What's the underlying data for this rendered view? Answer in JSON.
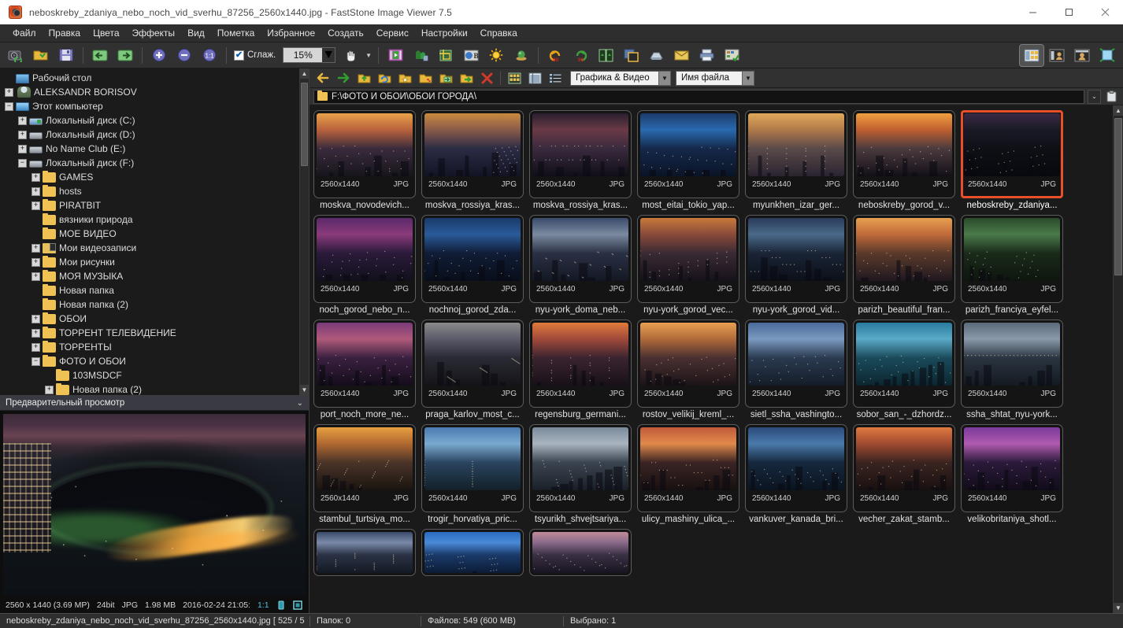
{
  "window": {
    "title": "neboskreby_zdaniya_nebo_noch_vid_sverhu_87256_2560x1440.jpg  -  FastStone Image Viewer 7.5",
    "app_icon": "faststone-icon",
    "minimize": "–",
    "maximize": "□",
    "close": "✕"
  },
  "menubar": {
    "items": [
      {
        "label": "Файл",
        "name": "menu-file"
      },
      {
        "label": "Правка",
        "name": "menu-edit"
      },
      {
        "label": "Цвета",
        "name": "menu-colors"
      },
      {
        "label": "Эффекты",
        "name": "menu-effects"
      },
      {
        "label": "Вид",
        "name": "menu-view"
      },
      {
        "label": "Пометка",
        "name": "menu-tag"
      },
      {
        "label": "Избранное",
        "name": "menu-favorites"
      },
      {
        "label": "Создать",
        "name": "menu-create"
      },
      {
        "label": "Сервис",
        "name": "menu-tools"
      },
      {
        "label": "Настройки",
        "name": "menu-settings"
      },
      {
        "label": "Справка",
        "name": "menu-help"
      }
    ]
  },
  "toolbar": {
    "smooth_label": "Сглаж.",
    "smooth_checked": "✔",
    "zoom_value": "15%",
    "dropdown_arrow": "▼",
    "buttons": [
      "camera-refresh-icon",
      "open-folder-icon",
      "save-icon",
      "previous-arrow-icon",
      "next-arrow-icon",
      "zoom-in-icon",
      "zoom-out-icon",
      "actual-size-icon"
    ],
    "buttons2": [
      "hand-pan-icon",
      "slideshow-icon",
      "resize-icon",
      "crop-icon",
      "color-adjust-icon",
      "brightness-icon",
      "red-eye-icon",
      "rotate-left-icon",
      "rotate-right-icon",
      "compare-icon",
      "drop-shadow-icon",
      "scan-icon",
      "email-icon",
      "print-icon",
      "contact-sheet-icon"
    ],
    "right_buttons": [
      "browser-view-icon",
      "preview-view-icon",
      "fullscreen-view-icon",
      "exit-icon"
    ]
  },
  "navbar": {
    "buttons": [
      "back-arrow-icon",
      "forward-arrow-icon",
      "up-folder-icon",
      "refresh-folder-icon",
      "favorites-folder-icon",
      "new-folder-icon",
      "copy-to-icon",
      "move-to-icon",
      "delete-icon",
      "thumbnail-view-icon",
      "list-view-icon",
      "detail-view-icon"
    ],
    "filter_select": "Графика & Видео",
    "sort_select": "Имя файла",
    "dropdown_arrow": "▼"
  },
  "pathbar": {
    "path": "F:\\ФОТО И ОБОИ\\ОБОИ ГОРОДА\\",
    "folder_icon": "folder-icon",
    "caret": "⌄",
    "copy_icon": "clipboard-icon"
  },
  "tree": {
    "scroll_up": "▲",
    "scroll_down": "▼",
    "items": [
      {
        "label": "Рабочий стол",
        "indent": 0,
        "expander": "",
        "icon": "desktop"
      },
      {
        "label": "ALEKSANDR BORISOV",
        "indent": 0,
        "expander": "+",
        "icon": "user"
      },
      {
        "label": "Этот компьютер",
        "indent": 0,
        "expander": "−",
        "icon": "pc"
      },
      {
        "label": "Локальный диск (C:)",
        "indent": 1,
        "expander": "+",
        "icon": "drive-sys"
      },
      {
        "label": "Локальный диск (D:)",
        "indent": 1,
        "expander": "+",
        "icon": "drive"
      },
      {
        "label": "No Name Club (E:)",
        "indent": 1,
        "expander": "+",
        "icon": "drive"
      },
      {
        "label": "Локальный диск (F:)",
        "indent": 1,
        "expander": "−",
        "icon": "drive"
      },
      {
        "label": "GAMES",
        "indent": 2,
        "expander": "+",
        "icon": "folder"
      },
      {
        "label": "hosts",
        "indent": 2,
        "expander": "+",
        "icon": "folder"
      },
      {
        "label": "PIRATBIT",
        "indent": 2,
        "expander": "+",
        "icon": "folder"
      },
      {
        "label": "вязники природа",
        "indent": 2,
        "expander": "",
        "icon": "folder"
      },
      {
        "label": "МОЕ ВИДЕО",
        "indent": 2,
        "expander": "",
        "icon": "folder"
      },
      {
        "label": "Мои видеозаписи",
        "indent": 2,
        "expander": "+",
        "icon": "vid"
      },
      {
        "label": "Мои рисунки",
        "indent": 2,
        "expander": "+",
        "icon": "folder"
      },
      {
        "label": "МОЯ МУЗЫКА",
        "indent": 2,
        "expander": "+",
        "icon": "folder"
      },
      {
        "label": "Новая папка",
        "indent": 2,
        "expander": "",
        "icon": "folder"
      },
      {
        "label": "Новая папка (2)",
        "indent": 2,
        "expander": "",
        "icon": "folder"
      },
      {
        "label": "ОБОИ",
        "indent": 2,
        "expander": "+",
        "icon": "folder"
      },
      {
        "label": "ТОРРЕНТ ТЕЛЕВИДЕНИЕ",
        "indent": 2,
        "expander": "+",
        "icon": "folder"
      },
      {
        "label": "ТОРРЕНТЫ",
        "indent": 2,
        "expander": "+",
        "icon": "folder"
      },
      {
        "label": "ФОТО И ОБОИ",
        "indent": 2,
        "expander": "−",
        "icon": "folder"
      },
      {
        "label": "103MSDCF",
        "indent": 3,
        "expander": "",
        "icon": "folder"
      },
      {
        "label": "Новая папка (2)",
        "indent": 3,
        "expander": "+",
        "icon": "folder"
      }
    ]
  },
  "preview": {
    "header": "Предварительный просмотр",
    "collapse_icon": "chevron-double-down-icon",
    "info": {
      "dimensions": "2560 x 1440 (3.69 MP)",
      "depth": "24bit",
      "format": "JPG",
      "size": "1.98 MB",
      "date": "2016-02-24 21:05:",
      "ratio": "1:1"
    }
  },
  "grid": {
    "meta_resolution": "2560x1440",
    "meta_format": "JPG",
    "scroll_up": "▲",
    "scroll_down": "▼",
    "selected_index": 6,
    "items": [
      {
        "name": "moskva_novodevich...",
        "art": "a1"
      },
      {
        "name": "moskva_rossiya_kras...",
        "art": "a2"
      },
      {
        "name": "moskva_rossiya_kras...",
        "art": "a3"
      },
      {
        "name": "most_eitai_tokio_yap...",
        "art": "a4"
      },
      {
        "name": "myunkhen_izar_ger...",
        "art": "a5"
      },
      {
        "name": "neboskreby_gorod_v...",
        "art": "a6"
      },
      {
        "name": "neboskreby_zdaniya...",
        "art": "a7"
      },
      {
        "name": "noch_gorod_nebo_n...",
        "art": "b1"
      },
      {
        "name": "nochnoj_gorod_zda...",
        "art": "b2"
      },
      {
        "name": "nyu-york_doma_neb...",
        "art": "b3"
      },
      {
        "name": "nyu-york_gorod_vec...",
        "art": "b4"
      },
      {
        "name": "nyu-york_gorod_vid...",
        "art": "b5"
      },
      {
        "name": "parizh_beautiful_fran...",
        "art": "b6"
      },
      {
        "name": "parizh_franciya_eyfel...",
        "art": "b7"
      },
      {
        "name": "port_noch_more_ne...",
        "art": "c1"
      },
      {
        "name": "praga_karlov_most_c...",
        "art": "c2"
      },
      {
        "name": "regensburg_germani...",
        "art": "c3"
      },
      {
        "name": "rostov_velikij_kreml_...",
        "art": "c4"
      },
      {
        "name": "sietl_ssha_vashingto...",
        "art": "c5"
      },
      {
        "name": "sobor_san_-_dzhordz...",
        "art": "c6"
      },
      {
        "name": "ssha_shtat_nyu-york...",
        "art": "c7"
      },
      {
        "name": "stambul_turtsiya_mo...",
        "art": "d1"
      },
      {
        "name": "trogir_horvatiya_pric...",
        "art": "d2"
      },
      {
        "name": "tsyurikh_shvejtsariya...",
        "art": "d3"
      },
      {
        "name": "ulicy_mashiny_ulica_...",
        "art": "d4"
      },
      {
        "name": "vankuver_kanada_bri...",
        "art": "d5"
      },
      {
        "name": "vecher_zakat_stamb...",
        "art": "d6"
      },
      {
        "name": "velikobritaniya_shotl...",
        "art": "d7"
      }
    ],
    "partial_row": [
      {
        "art": "e1"
      },
      {
        "art": "e2"
      },
      {
        "art": "e3"
      }
    ]
  },
  "statusbar": {
    "filename": "neboskreby_zdaniya_nebo_noch_vid_sverhu_87256_2560x1440.jpg [ 525 / 5",
    "folders": "Папок: 0",
    "files": "Файлов: 549 (600 MB)",
    "selected": "Выбрано: 1"
  },
  "colors": {
    "selection": "#e8502a",
    "accent_cyan": "#49c3e0",
    "panel_bg": "#1a1a1a",
    "toolbar_bg": "#313131"
  }
}
